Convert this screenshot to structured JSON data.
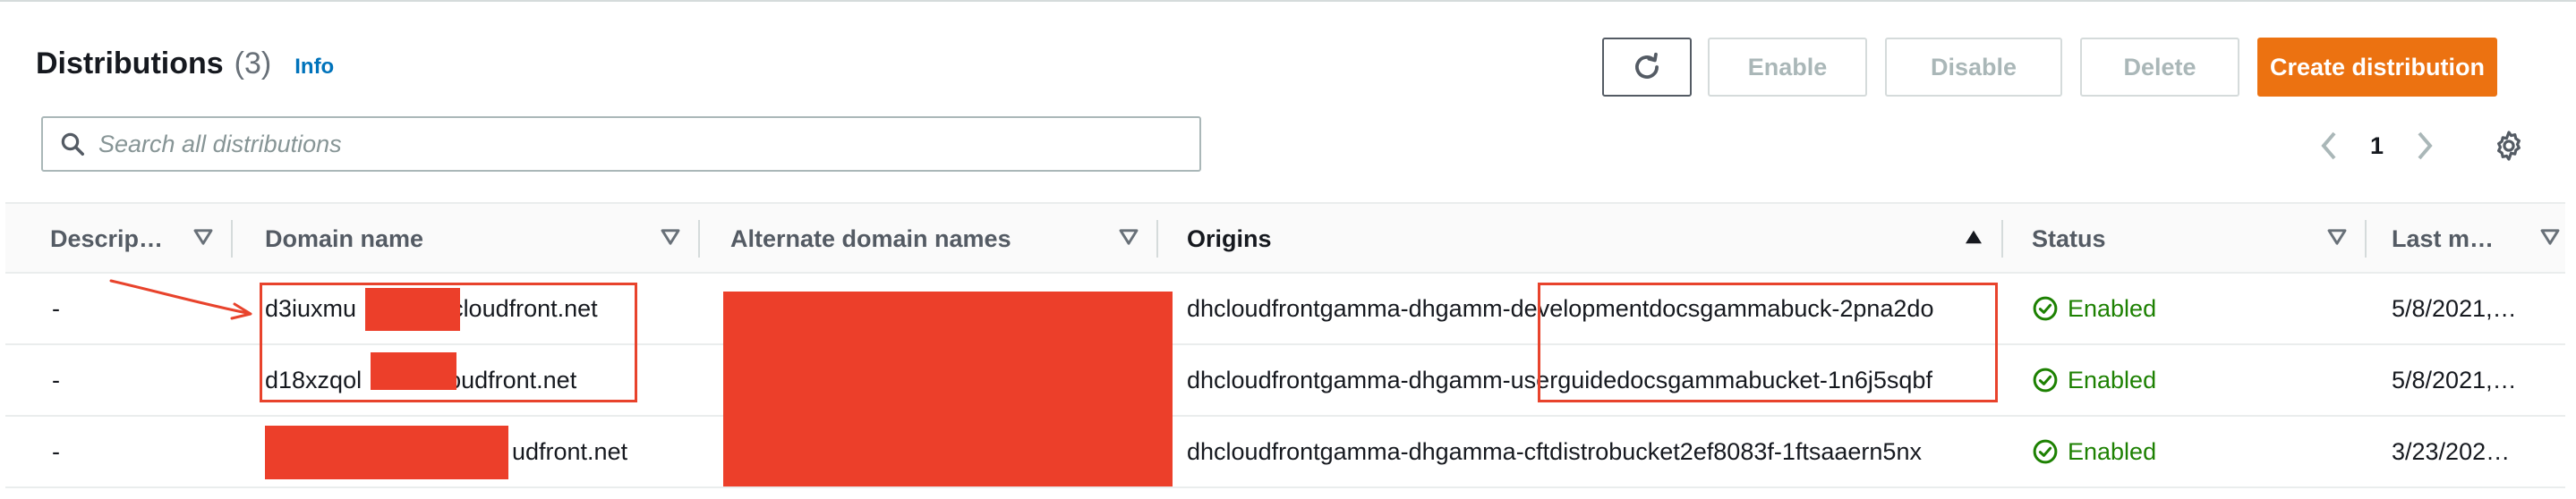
{
  "header": {
    "title": "Distributions",
    "count": "(3)",
    "info": "Info"
  },
  "actions": {
    "enable": "Enable",
    "disable": "Disable",
    "delete": "Delete",
    "create": "Create distribution"
  },
  "search": {
    "placeholder": "Search all distributions"
  },
  "pagination": {
    "page": "1"
  },
  "columns": [
    {
      "label": "Descrip…"
    },
    {
      "label": "Domain name"
    },
    {
      "label": "Alternate domain names"
    },
    {
      "label": "Origins"
    },
    {
      "label": "Status"
    },
    {
      "label": "Last m…"
    }
  ],
  "rows": [
    {
      "description": "-",
      "domain_prefix": "d3iuxmu",
      "domain_suffix": "cloudfront.net",
      "origin": "dhcloudfrontgamma-dhgamm-developmentdocsgammabuck-2pna2do",
      "status": "Enabled",
      "last_modified": "5/8/2021,…"
    },
    {
      "description": "-",
      "domain_prefix": "d18xzqol",
      "domain_suffix": "loudfront.net",
      "origin": "dhcloudfrontgamma-dhgamm-userguidedocsgammabucket-1n6j5sqbf",
      "status": "Enabled",
      "last_modified": "5/8/2021,…"
    },
    {
      "description": "-",
      "domain_prefix": "",
      "domain_suffix": "udfront.net",
      "origin": "dhcloudfrontgamma-dhgamma-cftdistrobucket2ef8083f-1ftsaaern5nx",
      "status": "Enabled",
      "last_modified": "3/23/202…"
    }
  ],
  "colors": {
    "accent": "#ec7211",
    "link": "#0073bb",
    "success": "#1d8102",
    "redaction": "#ec3f2a"
  },
  "icons": [
    "refresh-icon",
    "search-icon",
    "chevron-left-icon",
    "chevron-right-icon",
    "settings-gear-icon",
    "sort-down-icon",
    "sort-up-icon",
    "status-check-icon",
    "annotation-arrow-icon"
  ]
}
